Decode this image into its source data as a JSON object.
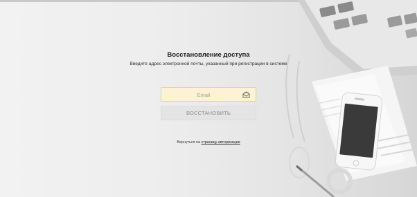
{
  "page": {
    "title": "Восстановление доступа",
    "subtitle": "Введите адрес электронной почты, указанный при регистрации в системе"
  },
  "form": {
    "email_placeholder": "Email",
    "email_value": "",
    "email_icon": "envelope-open-icon",
    "submit_label": "ВОССТАНОВИТЬ"
  },
  "footer": {
    "back_prefix": "Вернуться на",
    "back_link": "страницу авторизации"
  },
  "colors": {
    "email_field_bg": "#fbf3d3",
    "email_field_border": "#e6d48a",
    "button_bg": "#e4e4e4",
    "button_text": "#8a8a8a"
  }
}
